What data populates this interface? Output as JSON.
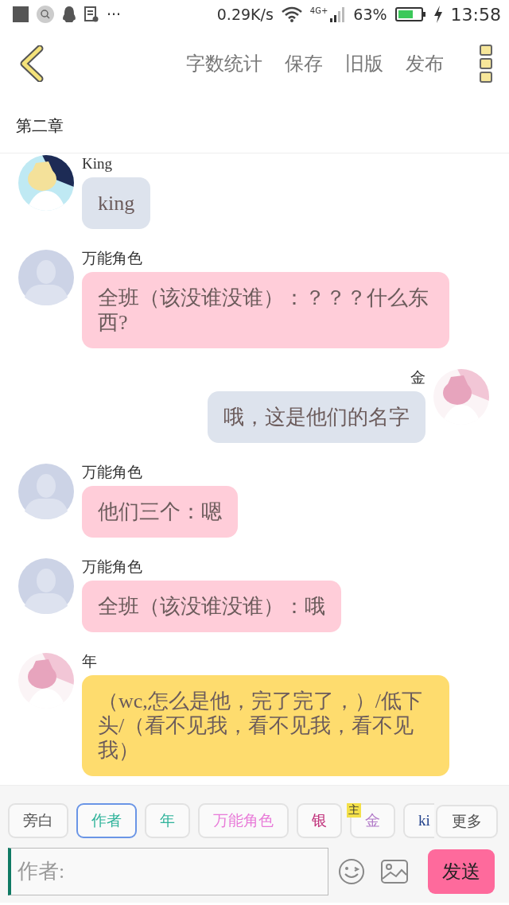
{
  "status_bar": {
    "overflow": "···",
    "speed": "0.29K/s",
    "network": "4G+",
    "battery": "63%",
    "time": "13:58"
  },
  "toolbar": {
    "actions": [
      "字数统计",
      "保存",
      "旧版",
      "发布"
    ]
  },
  "chapter": {
    "title": "第二章"
  },
  "messages": [
    {
      "outgoing": false,
      "kind": "picture",
      "name": "King",
      "text": "king",
      "color": "#dde3ed"
    },
    {
      "outgoing": false,
      "kind": "default",
      "name": "万能角色",
      "text": "全班（该没谁没谁）：？？？什么东西?",
      "color": "#ffcdd9"
    },
    {
      "outgoing": true,
      "kind": "picture",
      "name": "金",
      "text": "哦，这是他们的名字",
      "color": "#dde3ed"
    },
    {
      "outgoing": false,
      "kind": "default",
      "name": "万能角色",
      "text": "他们三个：嗯",
      "color": "#ffcdd9"
    },
    {
      "outgoing": false,
      "kind": "default",
      "name": "万能角色",
      "text": "全班（该没谁没谁）：哦",
      "color": "#ffcdd9"
    },
    {
      "outgoing": false,
      "kind": "picture",
      "name": "年",
      "text": "（wc,怎么是他，完了完了，）/低下头/（看不见我，看不见我，看不见我）",
      "color": "#fedc6e"
    }
  ],
  "roles": [
    {
      "label": "旁白",
      "color": "#555555",
      "selected": false
    },
    {
      "label": "作者",
      "color": "#2fb39a",
      "selected": true
    },
    {
      "label": "年",
      "color": "#2fb39a",
      "selected": false
    },
    {
      "label": "万能角色",
      "color": "#e87ad8",
      "selected": false
    },
    {
      "label": "银",
      "color": "#c0307a",
      "selected": false
    },
    {
      "label": "金",
      "color": "#b27ac8",
      "selected": false,
      "badge": "主"
    },
    {
      "label": "ki",
      "color": "#1f3f8a",
      "selected": false
    }
  ],
  "more_button": "更多",
  "composer": {
    "placeholder": "作者:",
    "send": "发送"
  }
}
